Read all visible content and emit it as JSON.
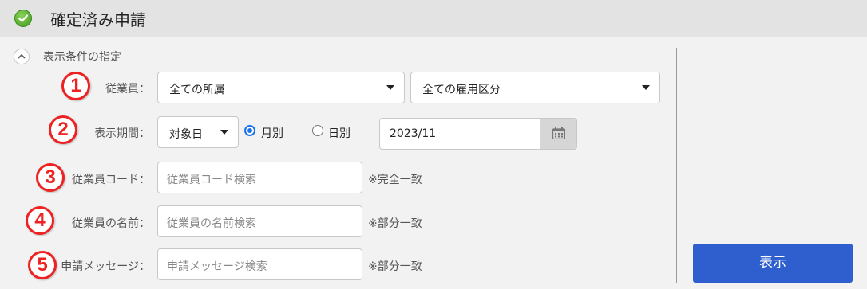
{
  "header": {
    "title": "確定済み申請",
    "check_icon": "check-circle-icon"
  },
  "filter": {
    "toggle_label": "表示条件の指定",
    "rows": [
      {
        "number": "1",
        "label": "従業員："
      },
      {
        "number": "2",
        "label": "表示期間："
      },
      {
        "number": "3",
        "label": "従業員コード："
      },
      {
        "number": "4",
        "label": "従業員の名前："
      },
      {
        "number": "5",
        "label": "申請メッセージ："
      }
    ],
    "employee": {
      "affiliation": "全ての所属",
      "employment_type": "全ての雇用区分"
    },
    "period": {
      "date_type": "対象日",
      "radio_monthly": "月別",
      "radio_daily": "日別",
      "selected": "monthly",
      "month_value": "2023/11"
    },
    "code": {
      "placeholder": "従業員コード検索",
      "note": "※完全一致"
    },
    "name": {
      "placeholder": "従業員の名前検索",
      "note": "※部分一致"
    },
    "message": {
      "placeholder": "申請メッセージ検索",
      "note": "※部分一致"
    }
  },
  "actions": {
    "show_button": "表示"
  },
  "colors": {
    "accent": "#2f5fcf",
    "badge": "#e22222",
    "check": "#4caf26"
  }
}
